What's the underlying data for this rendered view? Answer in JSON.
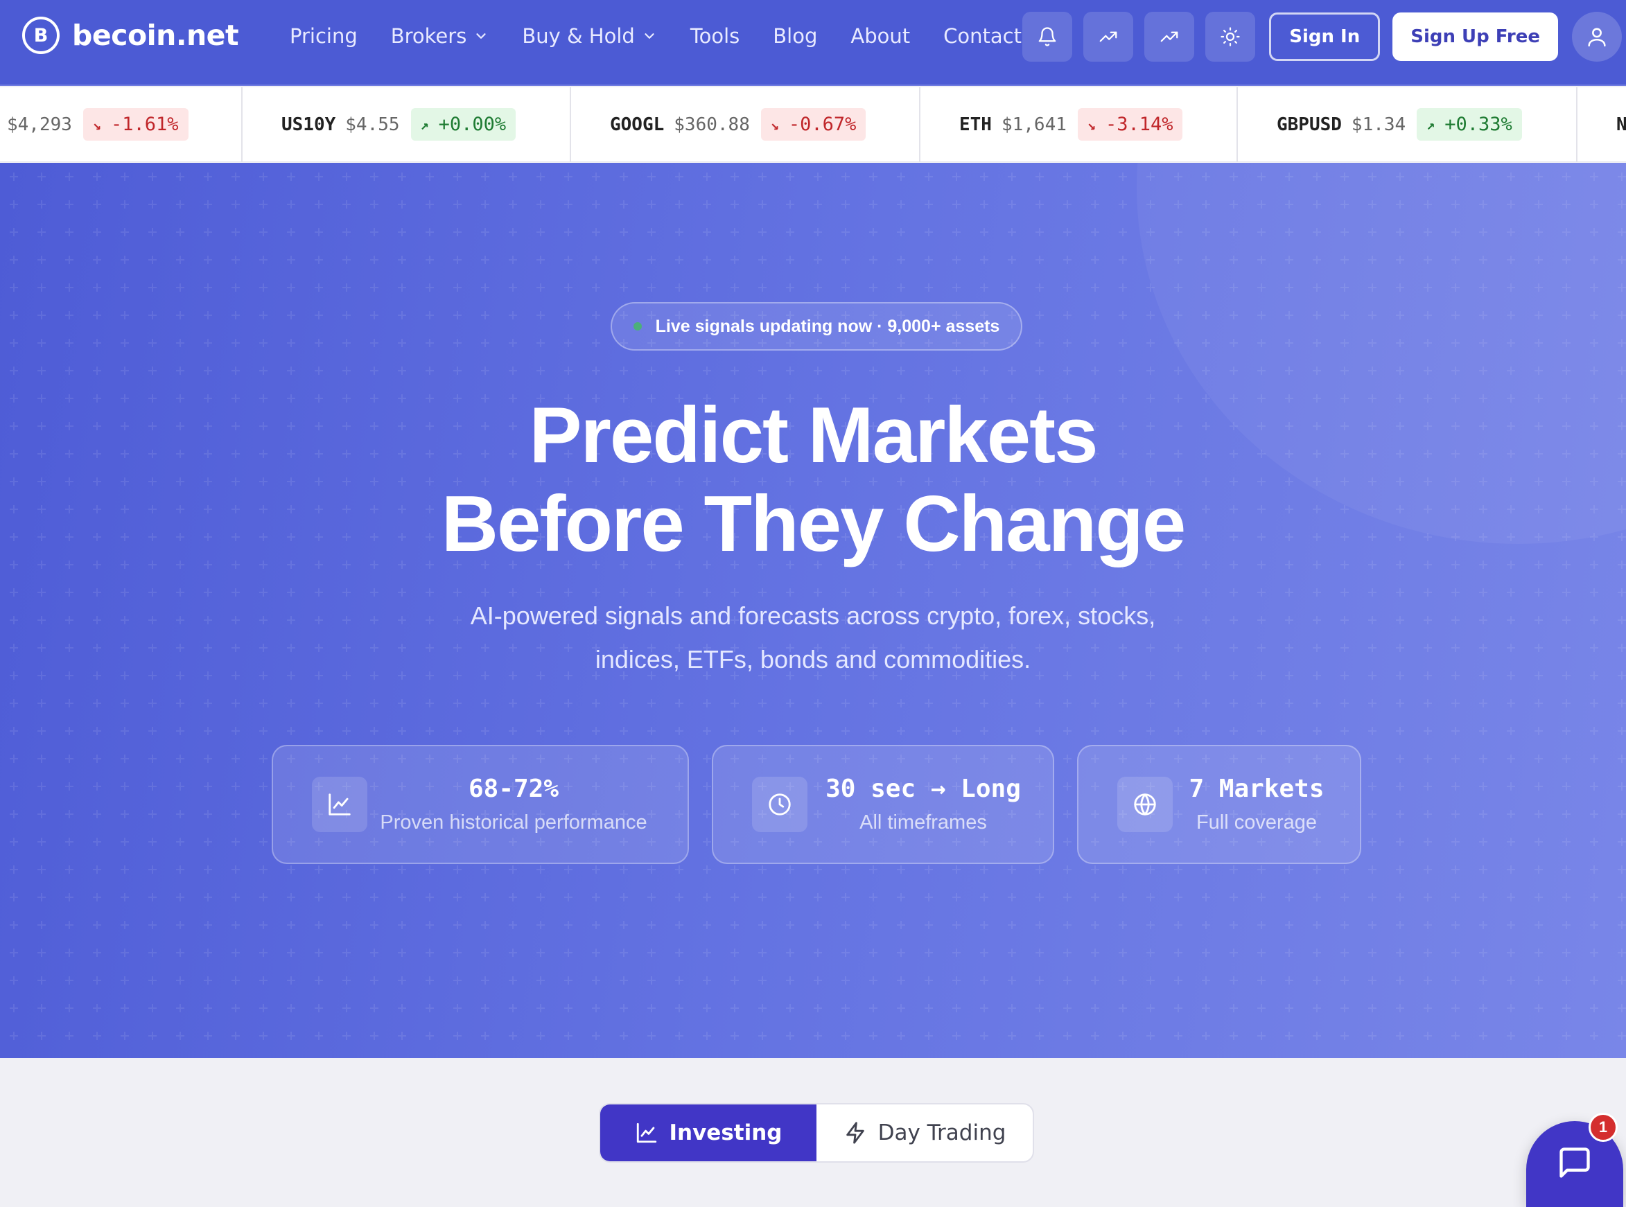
{
  "nav": {
    "brand": {
      "logo_letter": "B",
      "name": "becoin.net"
    },
    "links": [
      {
        "label": "Pricing",
        "dropdown": false
      },
      {
        "label": "Brokers",
        "dropdown": true
      },
      {
        "label": "Buy & Hold",
        "dropdown": true
      },
      {
        "label": "Tools",
        "dropdown": false
      },
      {
        "label": "Blog",
        "dropdown": false
      },
      {
        "label": "About",
        "dropdown": false
      },
      {
        "label": "Contact",
        "dropdown": false
      }
    ],
    "icons": [
      "bell-icon",
      "trending-up-icon",
      "trending-up-icon",
      "sun-icon",
      "user-icon"
    ],
    "sign_in": "Sign In",
    "sign_up": "Sign Up Free"
  },
  "ticker": [
    {
      "symbol": "",
      "price": "$4,293",
      "change": "-1.61%",
      "direction": "down"
    },
    {
      "symbol": "US10Y",
      "price": "$4.55",
      "change": "+0.00%",
      "direction": "up"
    },
    {
      "symbol": "GOOGL",
      "price": "$360.88",
      "change": "-0.67%",
      "direction": "down"
    },
    {
      "symbol": "ETH",
      "price": "$1,641",
      "change": "-3.14%",
      "direction": "down"
    },
    {
      "symbol": "GBPUSD",
      "price": "$1.34",
      "change": "+0.33%",
      "direction": "up"
    },
    {
      "symbol": "N",
      "price": "",
      "change": "",
      "direction": ""
    }
  ],
  "hero": {
    "live_badge": "Live signals updating now · 9,000+ assets",
    "headline_line1": "Predict Markets",
    "headline_line2": "Before They Change",
    "subline_line1": "AI-powered signals and forecasts across crypto, forex, stocks,",
    "subline_line2": "indices, ETFs, bonds and commodities.",
    "stats": [
      {
        "icon": "line-chart-icon",
        "value": "68-72%",
        "label": "Proven historical performance"
      },
      {
        "icon": "clock-icon",
        "value": "30 sec → Long",
        "label": "All timeframes"
      },
      {
        "icon": "globe-icon",
        "value": "7 Markets",
        "label": "Full coverage"
      }
    ]
  },
  "modes": {
    "investing": "Investing",
    "day_trading": "Day Trading",
    "active": "investing"
  },
  "chat": {
    "badge_count": "1"
  },
  "colors": {
    "nav_bg": "#4c5bd4",
    "hero_start": "#4e5cd6",
    "hero_end": "#7986e8",
    "accent": "#4136c6",
    "down": "#c0262a",
    "up": "#1e7b32"
  }
}
